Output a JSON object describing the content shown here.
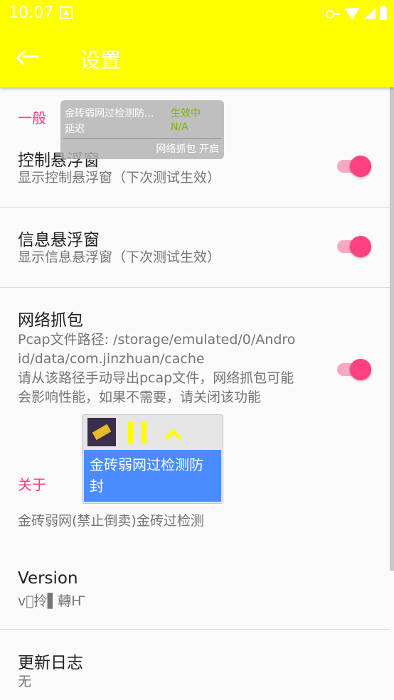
{
  "status_bar": {
    "time": "10:07"
  },
  "app_bar": {
    "title": "设置"
  },
  "sections": {
    "general": "一般",
    "about": "关于"
  },
  "prefs": {
    "control_float": {
      "title": "控制悬浮窗",
      "summary": "显示控制悬浮窗（下次测试生效）",
      "enabled": true
    },
    "info_float": {
      "title": "信息悬浮窗",
      "summary": "显示信息悬浮窗（下次测试生效）",
      "enabled": true
    },
    "capture": {
      "title": "网络抓包",
      "summary": "Pcap文件路径: /storage/emulated/0/Android/data/com.jinzhuan/cache\n请从该路径手动导出pcap文件，网络抓包可能会影响性能，如果不需要，请关闭该功能",
      "enabled": true
    },
    "about_text": "金砖弱网(禁止倒卖)金砖过检测",
    "version": {
      "title": "Version",
      "summary": "v\u0000拎▌轉Ҥ"
    },
    "changelog": {
      "title": "更新日志",
      "summary": "无"
    }
  },
  "float_info": {
    "app_name": "金砖弱网过检测防...",
    "status": "生效中",
    "delay_label": "延迟",
    "delay_value": "N/A",
    "footer": "网络抓包 开启"
  },
  "float_ctrl": {
    "banner": "金砖弱网过检测防封",
    "icons": [
      "app-icon",
      "pause-icon",
      "chevron-up-icon"
    ]
  },
  "colors": {
    "app_bar": "#ffff00",
    "accent": "#ff4081",
    "banner": "#4a8cff",
    "status_on": "#7db600"
  }
}
